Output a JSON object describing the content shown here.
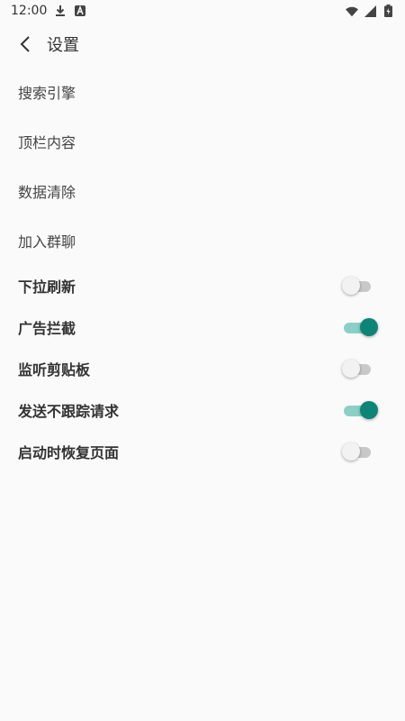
{
  "status_bar": {
    "time": "12:00",
    "icons": [
      "download-icon",
      "text-a-icon",
      "wifi-icon",
      "signal-icon",
      "battery-icon"
    ]
  },
  "app_bar": {
    "title": "设置"
  },
  "settings": {
    "plain_items": [
      {
        "label": "搜索引擎"
      },
      {
        "label": "顶栏内容"
      },
      {
        "label": "数据清除"
      },
      {
        "label": "加入群聊"
      }
    ],
    "toggle_items": [
      {
        "label": "下拉刷新",
        "enabled": false
      },
      {
        "label": "广告拦截",
        "enabled": true
      },
      {
        "label": "监听剪贴板",
        "enabled": false
      },
      {
        "label": "发送不跟踪请求",
        "enabled": true
      },
      {
        "label": "启动时恢复页面",
        "enabled": false
      }
    ]
  },
  "colors": {
    "accent": "#0c8577",
    "accent_track": "#8ccfc6",
    "off_track": "#c8c8c8",
    "background": "#fbfafa"
  }
}
